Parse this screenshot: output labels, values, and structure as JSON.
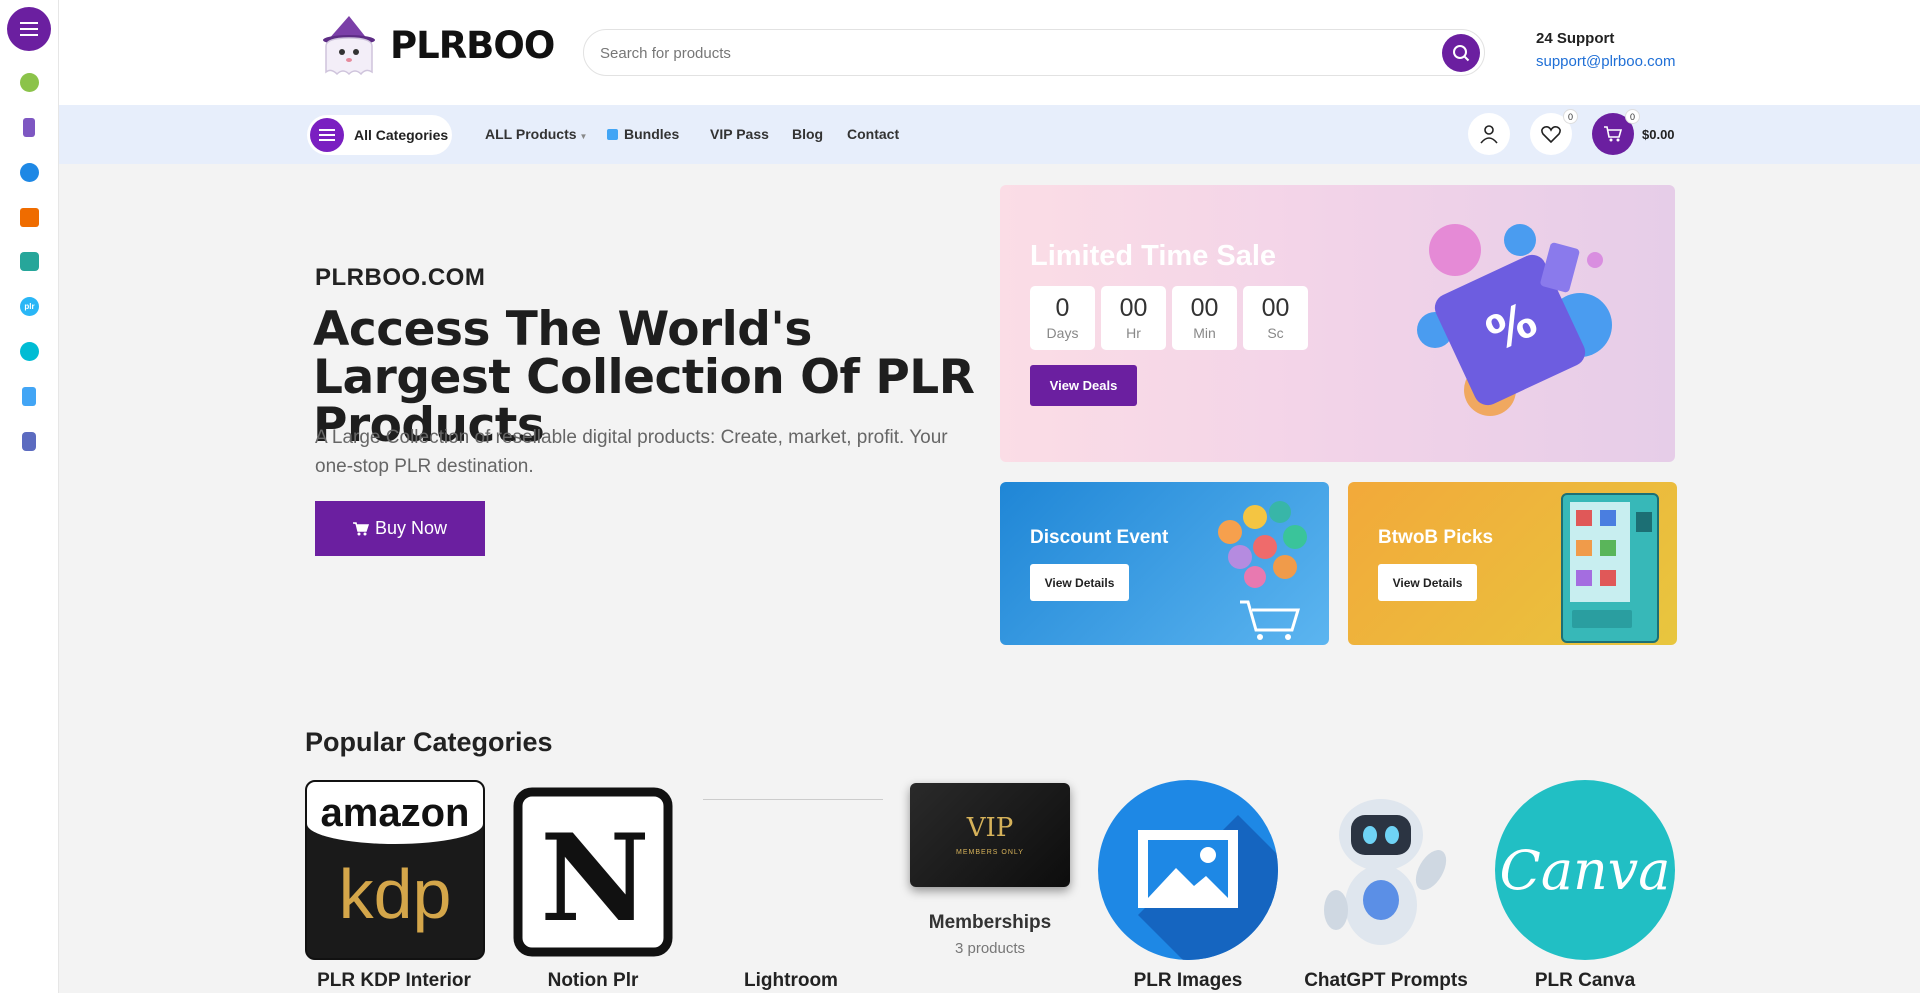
{
  "rail": {
    "icons": [
      {
        "name": "kdp-icon",
        "color": "#8bc34a"
      },
      {
        "name": "book-icon",
        "color": "#7e57c2"
      },
      {
        "name": "image-icon",
        "color": "#1e88e5"
      },
      {
        "name": "notebook-icon",
        "color": "#ef6c00"
      },
      {
        "name": "art-icon",
        "color": "#26a69a"
      },
      {
        "name": "plr-icon",
        "color": "#29b6f6"
      },
      {
        "name": "canva-icon",
        "color": "#00bcd4"
      },
      {
        "name": "basket-icon",
        "color": "#42a5f5"
      },
      {
        "name": "wizard-icon",
        "color": "#5c6bc0"
      }
    ]
  },
  "header": {
    "logo_text": "PLRBOO",
    "search_placeholder": "Search for products",
    "support_title": "24 Support",
    "support_email": "support@plrboo.com"
  },
  "nav": {
    "all_categories": "All Categories",
    "links": [
      "ALL Products",
      "Bundles",
      "VIP Pass",
      "Blog",
      "Contact"
    ],
    "wishlist_count": "0",
    "cart_count": "0",
    "cart_total": "$0.00"
  },
  "hero": {
    "site": "PLRBOO.COM",
    "title": "Access The World's Largest Collection Of PLR Products",
    "description": "A Large Collection of resellable digital products: Create, market, profit. Your one-stop PLR destination.",
    "button": "Buy Now"
  },
  "sale": {
    "title": "Limited Time Sale",
    "countdown": [
      {
        "value": "0",
        "unit": "Days"
      },
      {
        "value": "00",
        "unit": "Hr"
      },
      {
        "value": "00",
        "unit": "Min"
      },
      {
        "value": "00",
        "unit": "Sc"
      }
    ],
    "button": "View Deals"
  },
  "promos": {
    "discount": {
      "title": "Discount Event",
      "button": "View Details"
    },
    "btwob": {
      "title": "BtwoB Picks",
      "button": "View Details"
    }
  },
  "categories": {
    "title": "Popular Categories",
    "items": [
      {
        "name": "PLR KDP Interior"
      },
      {
        "name": "Notion Plr"
      },
      {
        "name": "Lightroom"
      },
      {
        "name": "Memberships",
        "count": "3 products"
      },
      {
        "name": "PLR Images"
      },
      {
        "name": "ChatGPT Prompts"
      },
      {
        "name": "PLR Canva"
      }
    ],
    "kdp_top": "amazon",
    "kdp_bottom": "kdp",
    "notion_letter": "N",
    "vip_text": "VIP",
    "vip_sub": "MEMBERS ONLY",
    "canva_text": "Canva"
  }
}
